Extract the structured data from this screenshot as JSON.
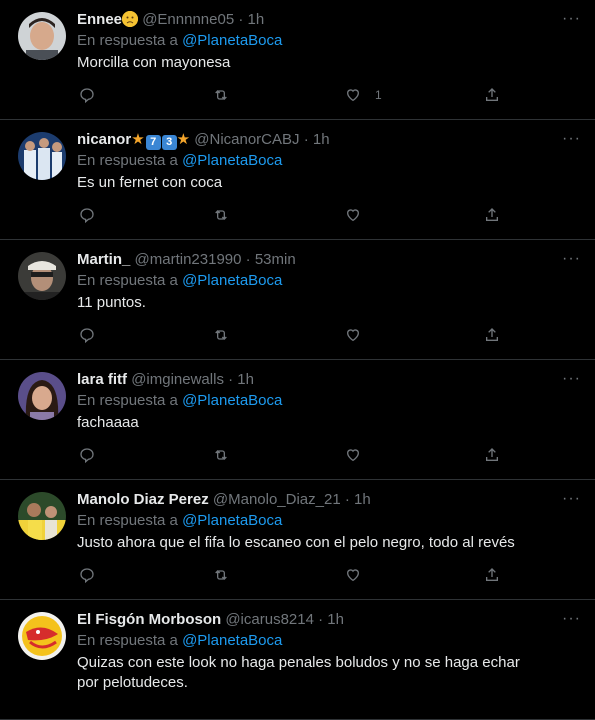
{
  "reply_prefix": "En respuesta a",
  "tweets": [
    {
      "name": "Ennee",
      "handle": "@Ennnnne05",
      "time": "1h",
      "mention": "@PlanetaBoca",
      "text": "Morcilla con mayonesa",
      "like_count": "1",
      "name_suffix_icon": "worried-face-emoji-icon"
    },
    {
      "name": "nicanor",
      "handle": "@NicanorCABJ",
      "time": "1h",
      "mention": "@PlanetaBoca",
      "text": "Es un fernet con coca",
      "badges": [
        "7",
        "3"
      ]
    },
    {
      "name": "Martin_",
      "handle": "@martin231990",
      "time": "53min",
      "mention": "@PlanetaBoca",
      "text": "11 puntos."
    },
    {
      "name": "lara fitf",
      "handle": "@imginewalls",
      "time": "1h",
      "mention": "@PlanetaBoca",
      "text": "fachaaaa"
    },
    {
      "name": "Manolo Diaz Perez",
      "handle": "@Manolo_Diaz_21",
      "time": "1h",
      "mention": "@PlanetaBoca",
      "text": "Justo ahora que el fifa lo escaneo con el pelo negro, todo al revés"
    },
    {
      "name": "El Fisgón Morboson",
      "handle": "@icarus8214",
      "time": "1h",
      "mention": "@PlanetaBoca",
      "text": "Quizas con este look no haga penales boludos y no se haga echar por pelotudeces."
    }
  ],
  "separator": "·",
  "colors": {
    "background": "#000000",
    "text": "#e7e9ea",
    "muted": "#71767b",
    "link": "#1d9bf0",
    "border": "#2f3336"
  }
}
